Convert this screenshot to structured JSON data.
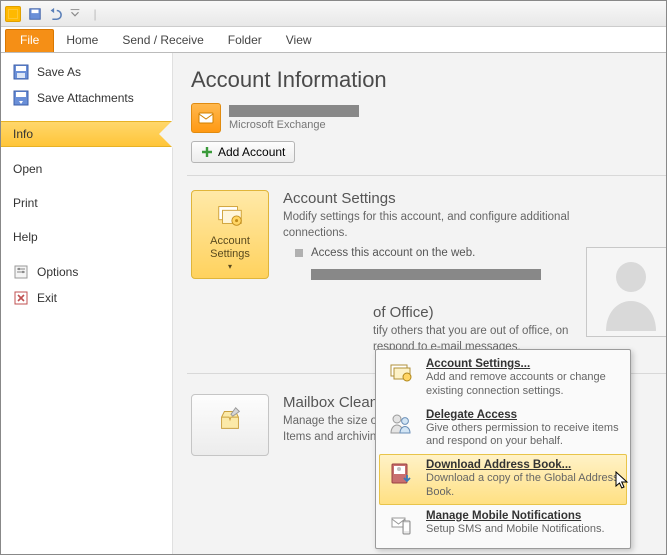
{
  "qat": {
    "icons": [
      "app-icon",
      "save-icon",
      "undo-icon",
      "dropdown-icon"
    ]
  },
  "tabs": {
    "file": "File",
    "items": [
      "Home",
      "Send / Receive",
      "Folder",
      "View"
    ]
  },
  "sidebar": {
    "saveAs": "Save As",
    "saveAttachments": "Save Attachments",
    "info": "Info",
    "open": "Open",
    "print": "Print",
    "help": "Help",
    "options": "Options",
    "exit": "Exit"
  },
  "page": {
    "title": "Account Information",
    "accountType": "Microsoft Exchange",
    "addAccount": "Add Account"
  },
  "accountSettings": {
    "btn": "Account Settings",
    "heading": "Account Settings",
    "desc": "Modify settings for this account, and configure additional connections.",
    "link": "Access this account on the web."
  },
  "dropdown": [
    {
      "title": "Account Settings...",
      "desc": "Add and remove accounts or change existing connection settings."
    },
    {
      "title": "Delegate Access",
      "desc": "Give others permission to receive items and respond on your behalf."
    },
    {
      "title": "Download Address Book...",
      "desc": "Download a copy of the Global Address Book."
    },
    {
      "title": "Manage Mobile Notifications",
      "desc": "Setup SMS and Mobile Notifications."
    }
  ],
  "autoReply": {
    "heading": "of Office)",
    "desc1": "tify others that you are out of office, on",
    "desc2": "respond to e-mail messages."
  },
  "cleanup": {
    "heading": "Mailbox Cleanup",
    "desc": "Manage the size of your mailbox by emptying Deleted Items and archiving."
  }
}
